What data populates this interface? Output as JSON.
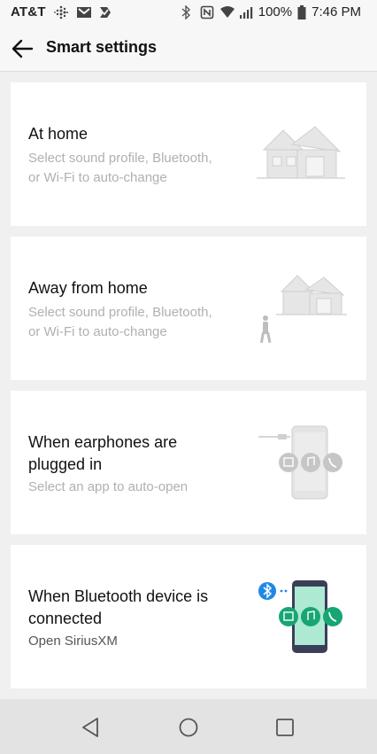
{
  "status_bar": {
    "carrier": "AT&T",
    "battery": "100%",
    "time": "7:46 PM",
    "icons": [
      "fitbit-icon",
      "gmail-icon",
      "tasks-icon",
      "bluetooth-icon",
      "nfc-icon",
      "wifi-icon",
      "signal-icon",
      "battery-icon"
    ]
  },
  "header": {
    "title": "Smart settings",
    "back_icon": "arrow-left-icon"
  },
  "cards": [
    {
      "title_lines": [
        "At home"
      ],
      "subtitle_lines": [
        "Select sound profile, Bluetooth,",
        "or Wi-Fi to auto-change"
      ],
      "illustration": "house-icon"
    },
    {
      "title_lines": [
        "Away from home"
      ],
      "subtitle_lines": [
        "Select sound profile, Bluetooth,",
        "or Wi-Fi to auto-change"
      ],
      "illustration": "walking-away-from-house-icon"
    },
    {
      "title_lines": [
        "When earphones are",
        "plugged in"
      ],
      "subtitle_lines": [
        "Select an app to auto-open"
      ],
      "illustration": "phone-earphones-icon"
    },
    {
      "title_lines": [
        "When Bluetooth device is",
        "connected"
      ],
      "subtitle_lines": [
        "Open SiriusXM"
      ],
      "illustration": "phone-bluetooth-icon"
    }
  ],
  "nav_bar": {
    "buttons": [
      "back-triangle-icon",
      "home-circle-icon",
      "recents-square-icon"
    ]
  },
  "colors": {
    "accent_green": "#17a673",
    "phone_screen": "#aee9d4",
    "bluetooth_blue": "#1e88e5",
    "subtitle_gray": "#b0b0b0",
    "background": "#f0f0f0"
  }
}
